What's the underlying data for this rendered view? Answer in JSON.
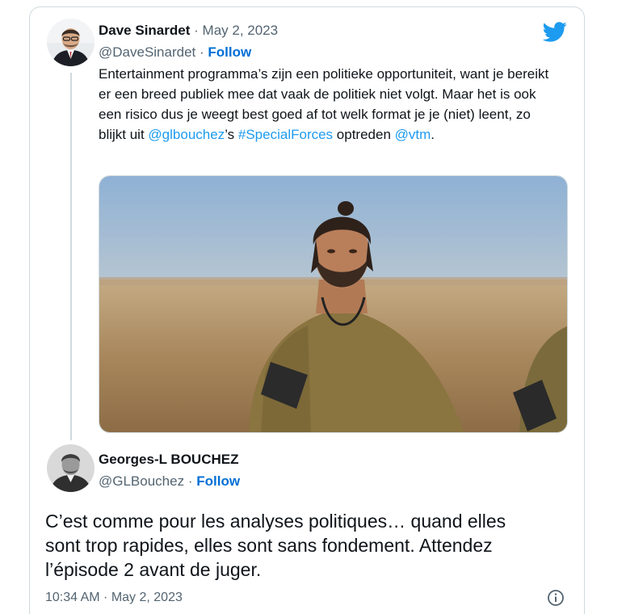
{
  "tweet": {
    "author_name": "Dave Sinardet",
    "separator": "·",
    "date": "May 2, 2023",
    "handle": "@DaveSinardet",
    "follow_label": "Follow",
    "text_parts": {
      "p1": "Entertainment programma’s zijn een politieke opportuniteit, want je bereikt er een breed publiek mee dat vaak de politiek niet volgt. Maar het is ook een risico dus je weegt best goed af tot welk format je je (niet) leent, zo blijkt uit ",
      "mention1": "@glbouchez",
      "p2": "’s ",
      "hashtag": "#SpecialForces",
      "p3": " optreden ",
      "mention2": "@vtm",
      "p4": "."
    }
  },
  "reply": {
    "author_name": "Georges-L BOUCHEZ",
    "handle": "@GLBouchez",
    "separator": "·",
    "follow_label": "Follow",
    "text": "C’est comme pour les analyses politiques… quand elles sont trop rapides, elles sont sans fondement. Attendez l’épisode 2 avant de juger.",
    "timestamp": "10:34 AM · May 2, 2023"
  },
  "icons": {
    "brand": "twitter-bird-icon",
    "info": "info-icon"
  },
  "colors": {
    "link": "#1d9bf0",
    "follow": "#006fd6",
    "secondary_text": "#536471",
    "border": "#cfd9de"
  }
}
